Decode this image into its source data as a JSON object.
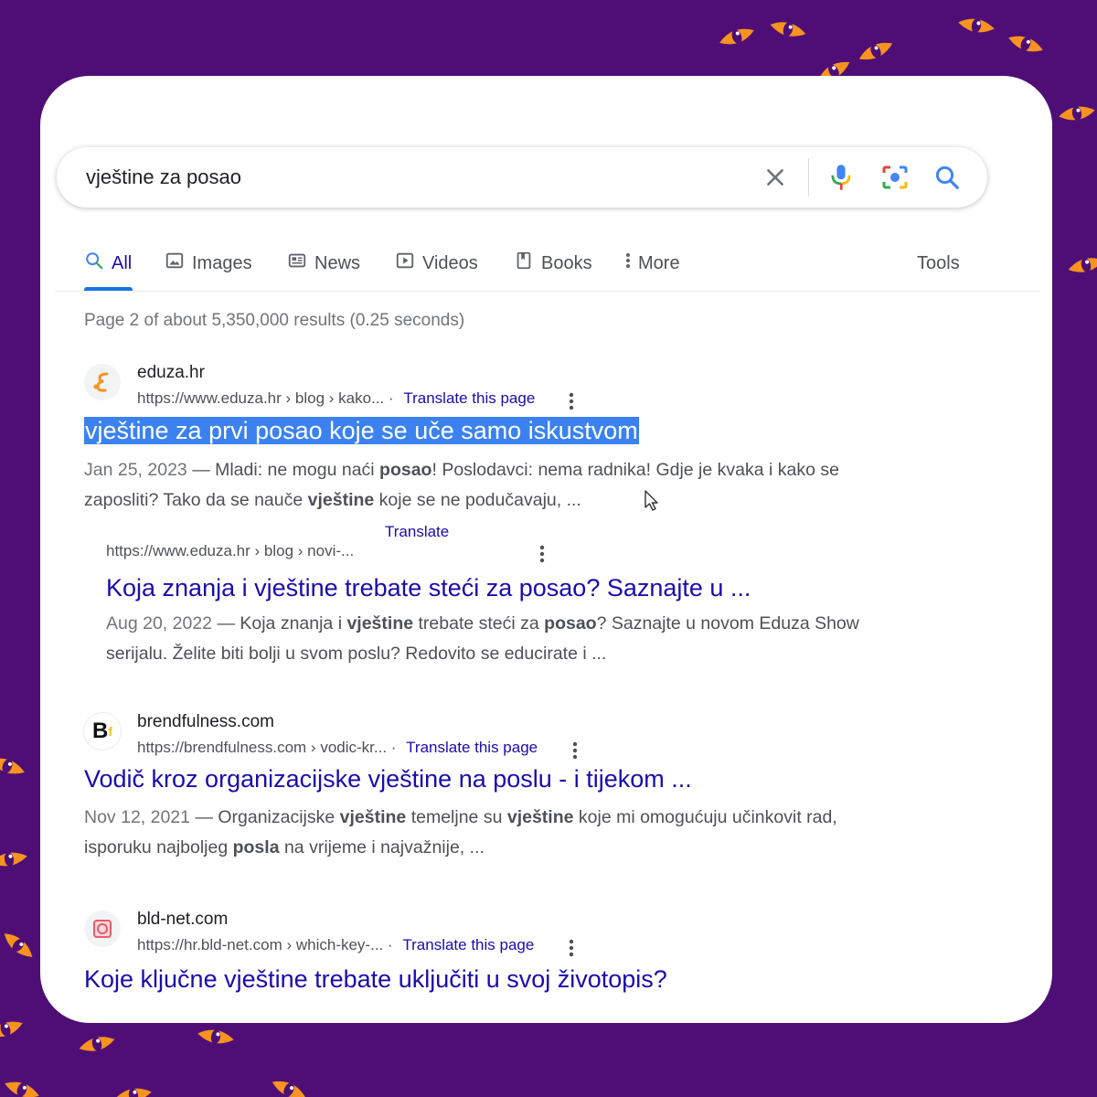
{
  "search": {
    "query": "vještine za posao",
    "clear_icon": "close-icon",
    "voice_icon": "microphone-icon",
    "lens_icon": "camera-icon",
    "search_icon": "search-icon"
  },
  "tabs": [
    {
      "label": "All",
      "icon": "search-icon",
      "active": true
    },
    {
      "label": "Images",
      "icon": "image-icon"
    },
    {
      "label": "News",
      "icon": "news-icon"
    },
    {
      "label": "Videos",
      "icon": "video-icon"
    },
    {
      "label": "Books",
      "icon": "book-icon"
    },
    {
      "label": "More",
      "icon": "more-vert-icon"
    }
  ],
  "tools_label": "Tools",
  "stats": "Page 2 of about 5,350,000 results (0.25 seconds)",
  "results": [
    {
      "site": "eduza.hr",
      "url": "https://www.eduza.hr › blog › kako...",
      "translate": "Translate this page",
      "title": "vještine za prvi posao koje se uče samo iskustvom",
      "date": "Jan 25, 2023",
      "snippet_parts": [
        "— Mladi: ne mogu naći ",
        "posao",
        "! Poslodavci: nema radnika! Gdje je kvaka i kako se zaposliti? Tako da se nauče ",
        "vještine",
        " koje se ne podučavaju, ..."
      ]
    },
    {
      "url": "https://www.eduza.hr › blog › novi-...",
      "translate": "Translate this page",
      "title": "Koja znanja i vještine trebate steći za posao? Saznajte u ...",
      "date": "Aug 20, 2022",
      "snippet_parts": [
        "— Koja znanja i ",
        "vještine",
        " trebate steći za ",
        "posao",
        "? Saznajte u novom Eduza Show serijalu. Želite biti bolji u svom poslu? Redovito se educirate i ..."
      ]
    },
    {
      "site": "brendfulness.com",
      "url": "https://brendfulness.com › vodic-kr...",
      "translate": "Translate this page",
      "title": "Vodič kroz organizacijske vještine na poslu - i tijekom ...",
      "date": "Nov 12, 2021",
      "snippet_parts": [
        "— Organizacijske ",
        "vještine",
        " temeljne su ",
        "vještine",
        " koje mi omogućuju učinkovit rad, isporuku najboljeg ",
        "posla",
        " na vrijeme i najvažnije, ..."
      ]
    },
    {
      "site": "bld-net.com",
      "url": "https://hr.bld-net.com › which-key-...",
      "translate": "Translate this page",
      "title": "Koje ključne vještine trebate uključiti u svoj životopis?"
    }
  ],
  "favicons": {
    "eduza": "eduza-logo-icon",
    "brendfulness": "Bf",
    "bldnet": "bldnet-logo-icon"
  },
  "colors": {
    "background": "#4f0e76",
    "eye": "#f7931e",
    "link": "#1a0dab",
    "accent": "#1a73e8"
  }
}
